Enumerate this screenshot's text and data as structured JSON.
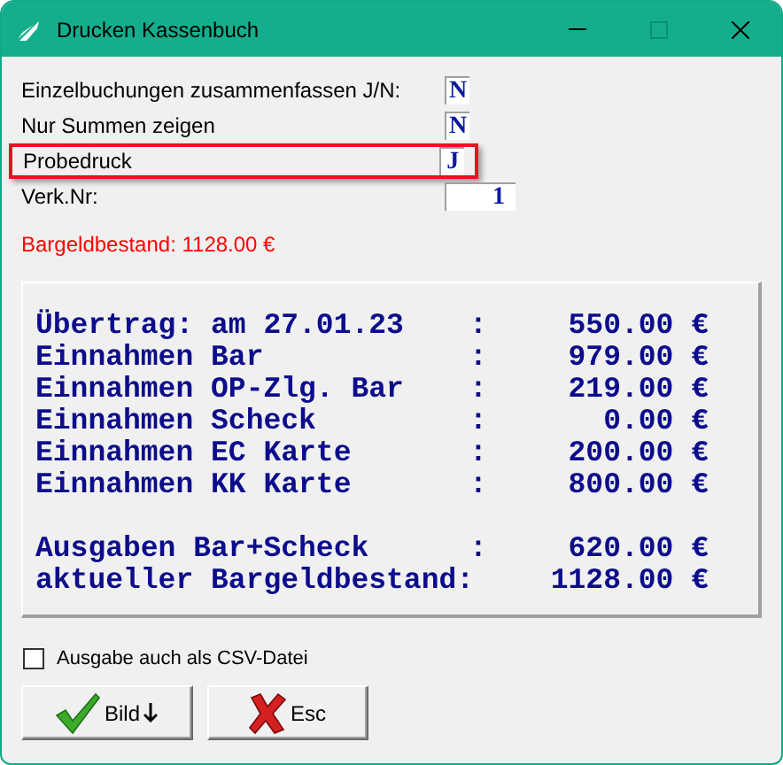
{
  "window": {
    "title": "Drucken Kassenbuch"
  },
  "fields": [
    {
      "label": "Einzelbuchungen zusammenfassen J/N:",
      "value": "N",
      "kind": "flag",
      "highlighted": false
    },
    {
      "label": "Nur Summen zeigen",
      "value": "N",
      "kind": "flag",
      "highlighted": false
    },
    {
      "label": "Probedruck",
      "value": "J",
      "kind": "flag",
      "highlighted": true
    },
    {
      "label": "Verk.Nr:",
      "value": "1",
      "kind": "number",
      "highlighted": false
    }
  ],
  "cash_balance": "Bargeldbestand: 1128.00 €",
  "report": [
    {
      "kind": "line",
      "label": "Übertrag: am 27.01.23",
      "separator": ":",
      "amount": "550.00 €"
    },
    {
      "kind": "line",
      "label": "Einnahmen Bar",
      "separator": ":",
      "amount": "979.00 €"
    },
    {
      "kind": "line",
      "label": "Einnahmen OP-Zlg. Bar",
      "separator": ":",
      "amount": "219.00 €"
    },
    {
      "kind": "line",
      "label": "Einnahmen Scheck",
      "separator": ":",
      "amount": "0.00 €"
    },
    {
      "kind": "line",
      "label": "Einnahmen EC Karte",
      "separator": ":",
      "amount": "200.00 €"
    },
    {
      "kind": "line",
      "label": "Einnahmen KK Karte",
      "separator": ":",
      "amount": "800.00 €"
    },
    {
      "kind": "gap"
    },
    {
      "kind": "line",
      "label": "Ausgaben Bar+Scheck",
      "separator": ":",
      "amount": "620.00 €"
    },
    {
      "kind": "line",
      "label": "aktueller Bargeldbestand:",
      "amount": "1128.00 €"
    }
  ],
  "csv_option": {
    "label": "Ausgabe auch als CSV-Datei",
    "checked": false
  },
  "buttons": [
    {
      "label": "Bild",
      "kind": "ok"
    },
    {
      "label": "Esc",
      "kind": "cancel"
    }
  ]
}
